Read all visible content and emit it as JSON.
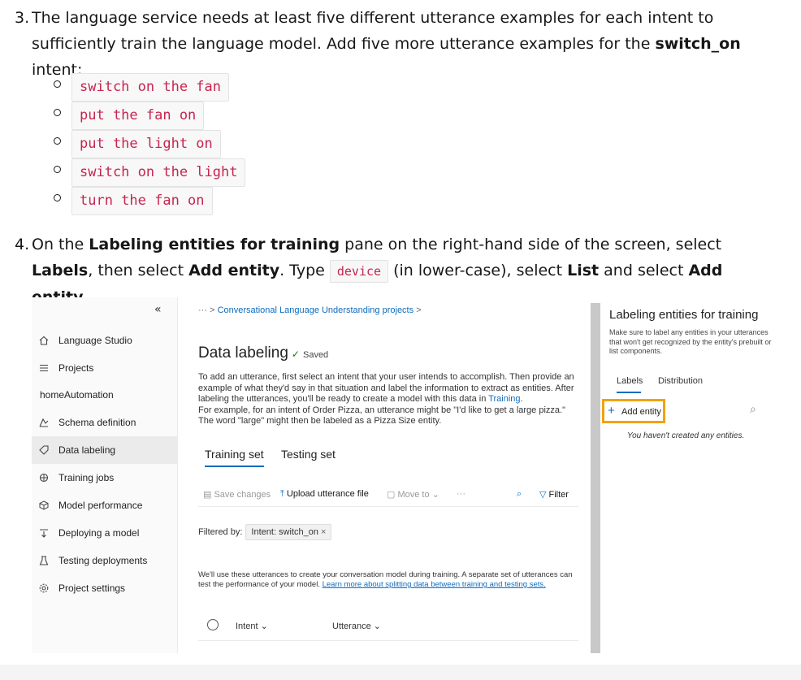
{
  "step3": {
    "number": "3.",
    "text_before": "The language service needs at least five different utterance examples for each intent to sufficiently train the language model. Add five more utterance examples for the ",
    "bold_intent": "switch_on",
    "text_after": " intent:",
    "utterances": [
      "switch on the fan",
      "put the fan on",
      "put the light on",
      "switch on the light",
      "turn the fan on"
    ]
  },
  "step4": {
    "number": "4.",
    "p1": "On the ",
    "b1": "Labeling entities for training",
    "p2": " pane on the right-hand side of the screen, select ",
    "b2": "Labels",
    "p3": ", then select ",
    "b3": "Add entity",
    "p4": ". Type ",
    "code": "device",
    "p5": " (in lower-case), select ",
    "b4": "List",
    "p6": " and select ",
    "b5": "Add entity",
    "p7": "."
  },
  "studio": {
    "collapse_glyph": "«",
    "breadcrumb": {
      "dots": "···",
      "sep": ">",
      "link": "Conversational Language Understanding projects"
    },
    "nav": [
      {
        "label": "Language Studio",
        "icon": "home-icon"
      },
      {
        "label": "Projects",
        "icon": "list-icon"
      },
      {
        "label": "Schema definition",
        "icon": "schema-icon"
      },
      {
        "label": "Data labeling",
        "icon": "tag-icon",
        "active": true
      },
      {
        "label": "Training jobs",
        "icon": "training-icon"
      },
      {
        "label": "Model performance",
        "icon": "cube-icon"
      },
      {
        "label": "Deploying a model",
        "icon": "deploy-icon"
      },
      {
        "label": "Testing deployments",
        "icon": "flask-icon"
      },
      {
        "label": "Project settings",
        "icon": "gear-icon"
      }
    ],
    "project_name": "homeAutomation",
    "title": "Data labeling",
    "saved": "Saved",
    "desc1": "To add an utterance, first select an intent that your user intends to accomplish. Then provide an example of what they'd say in that situation and label the information to extract as entities. After labeling the utterances, you'll be ready to create a model with this data in ",
    "desc1_link": "Training",
    "desc1_end": ".",
    "desc2": "For example, for an intent of Order Pizza, an utterance might be \"I'd like to get a large pizza.\" The word \"large\" might then be labeled as a Pizza Size entity.",
    "tabs": [
      "Training set",
      "Testing set"
    ],
    "toolbar": {
      "save": "Save changes",
      "upload": "Upload utterance file",
      "move": "Move to",
      "more": "···",
      "filter": "Filter"
    },
    "filtered_by": "Filtered by:",
    "filter_pill": "Intent: switch_on",
    "note": "We'll use these utterances to create your conversation model during training. A separate set of utterances can test the performance of your model. ",
    "note_link": "Learn more about splitting data between training and testing sets.",
    "columns": [
      "Intent",
      "Utterance"
    ]
  },
  "panel": {
    "title": "Labeling entities for training",
    "desc": "Make sure to label any entities in your utterances that won't get recognized by the entity's prebuilt or list components.",
    "tabs": [
      "Labels",
      "Distribution"
    ],
    "add_entity": "Add entity",
    "empty": "You haven't created any entities."
  },
  "colors": {
    "accent": "#0f6cbd",
    "highlight": "#f0a30a",
    "code": "#c7254e"
  }
}
